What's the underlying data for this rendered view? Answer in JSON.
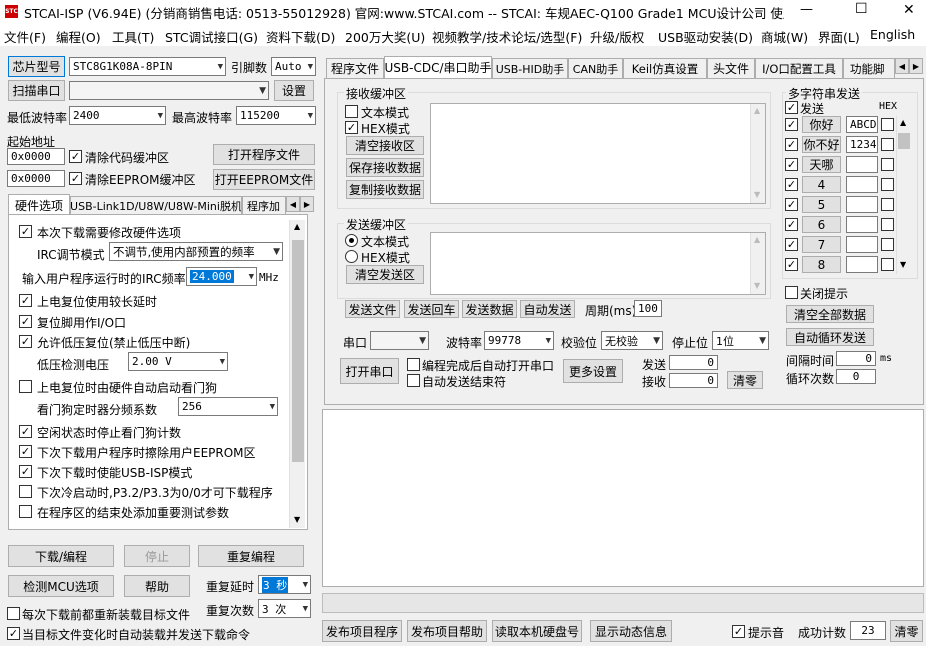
{
  "window": {
    "title": "STCAI-ISP (V6.94E) (分销商销售电话: 0513-55012928) 官网:www.STCAI.com  -- STCAI: 车规AEC-Q100 Grade1 MCU设计公司 使用本司...",
    "logo_text": "STC",
    "minimize": "—",
    "maximize": "☐",
    "close": "✕"
  },
  "menu": [
    "文件(F)",
    "编程(O)",
    "工具(T)",
    "STC调试接口(G)",
    "资料下载(D)",
    "200万大奖(U)",
    "视频教学/技术论坛/选型(F)",
    "升级/版权",
    "USB驱动安装(D)",
    "商城(W)",
    "界面(L)",
    "English"
  ],
  "left": {
    "chip_model_btn": "芯片型号",
    "chip_model_value": "STC8G1K08A-8PIN",
    "pin_label": "引脚数",
    "pin_value": "Auto",
    "scan_port_btn": "扫描串口",
    "port_value": "",
    "settings_btn": "设置",
    "min_baud_label": "最低波特率",
    "min_baud_value": "2400",
    "max_baud_label": "最高波特率",
    "max_baud_value": "115200",
    "start_addr_label": "起始地址",
    "addr1": "0x0000",
    "clear_code_label": "清除代码缓冲区",
    "open_prog_btn": "打开程序文件",
    "addr2": "0x0000",
    "clear_eeprom_label": "清除EEPROM缓冲区",
    "open_eeprom_btn": "打开EEPROM文件",
    "tabs": [
      "硬件选项",
      "USB-Link1D/U8W/U8W-Mini脱机",
      "程序加"
    ],
    "hw": {
      "modify_hw": "本次下载需要修改硬件选项",
      "irc_mode_label": "IRC调节模式",
      "irc_mode_value": "不调节,使用内部预置的频率",
      "irc_freq_label": "输入用户程序运行时的IRC频率",
      "irc_freq_value": "24.000",
      "irc_unit": "MHz",
      "opt1": "上电复位使用较长延时",
      "opt2": "复位脚用作I/O口",
      "opt3": "允许低压复位(禁止低压中断)",
      "lv_label": "低压检测电压",
      "lv_value": "2.00 V",
      "opt4": "上电复位时由硬件自动启动看门狗",
      "wdt_label": "看门狗定时器分频系数",
      "wdt_value": "256",
      "opt5": "空闲状态时停止看门狗计数",
      "opt6": "下次下载用户程序时擦除用户EEPROM区",
      "opt7": "下次下载时使能USB-ISP模式",
      "opt8": "下次冷启动时,P3.2/P3.3为0/0才可下载程序",
      "opt9": "在程序区的结束处添加重要测试参数"
    },
    "download_btn": "下载/编程",
    "stop_btn": "停止",
    "reprogram_btn": "重复编程",
    "detect_btn": "检测MCU选项",
    "help_btn": "帮助",
    "repeat_delay_label": "重复延时",
    "repeat_delay_value": "3 秒",
    "repeat_count_label": "重复次数",
    "repeat_count_value": "3 次",
    "reload_label": "每次下载前都重新装载目标文件",
    "auto_load_label": "当目标文件变化时自动装载并发送下载命令"
  },
  "right_tabs": [
    "程序文件",
    "USB-CDC/串口助手",
    "USB-HID助手",
    "CAN助手",
    "Keil仿真设置",
    "头文件",
    "I/O口配置工具",
    "功能脚"
  ],
  "serial": {
    "recv_title": "接收缓冲区",
    "text_mode": "文本模式",
    "hex_mode": "HEX模式",
    "clear_recv": "清空接收区",
    "save_recv": "保存接收数据",
    "copy_recv": "复制接收数据",
    "send_title": "发送缓冲区",
    "send_text_mode": "文本模式",
    "send_hex_mode": "HEX模式",
    "clear_send": "清空发送区",
    "send_file": "发送文件",
    "send_enter": "发送回车",
    "send_data": "发送数据",
    "auto_send": "自动发送",
    "period_label": "周期(ms)",
    "period_value": "100",
    "port_label": "串口",
    "port_value": "",
    "baud_label": "波特率",
    "baud_value": "99778",
    "parity_label": "校验位",
    "parity_value": "无校验",
    "stop_label": "停止位",
    "stop_value": "1位",
    "open_port": "打开串口",
    "auto_open": "编程完成后自动打开串口",
    "auto_end": "自动发送结束符",
    "more_settings": "更多设置",
    "tx_label": "发送",
    "tx_value": "0",
    "rx_label": "接收",
    "rx_value": "0",
    "clear_count": "清零"
  },
  "multi": {
    "title": "多字符串发送",
    "send_hdr": "发送",
    "hex_hdr": "HEX",
    "rows": [
      {
        "label": "你好",
        "data": "ABCD"
      },
      {
        "label": "你不好",
        "data": "1234"
      },
      {
        "label": "天哪",
        "data": ""
      },
      {
        "label": "4",
        "data": ""
      },
      {
        "label": "5",
        "data": ""
      },
      {
        "label": "6",
        "data": ""
      },
      {
        "label": "7",
        "data": ""
      },
      {
        "label": "8",
        "data": ""
      }
    ],
    "close_tip": "关闭提示",
    "clear_all": "清空全部数据",
    "auto_loop": "自动循环发送",
    "interval_label": "间隔时间",
    "interval_value": "0",
    "interval_unit": "ms",
    "loop_label": "循环次数",
    "loop_value": "0"
  },
  "bottom": {
    "publish": "发布项目程序",
    "publish_help": "发布项目帮助",
    "read_hdd": "读取本机硬盘号",
    "show_dynamic": "显示动态信息",
    "beep_label": "提示音",
    "success_label": "成功计数",
    "success_value": "23",
    "clear": "清零"
  }
}
